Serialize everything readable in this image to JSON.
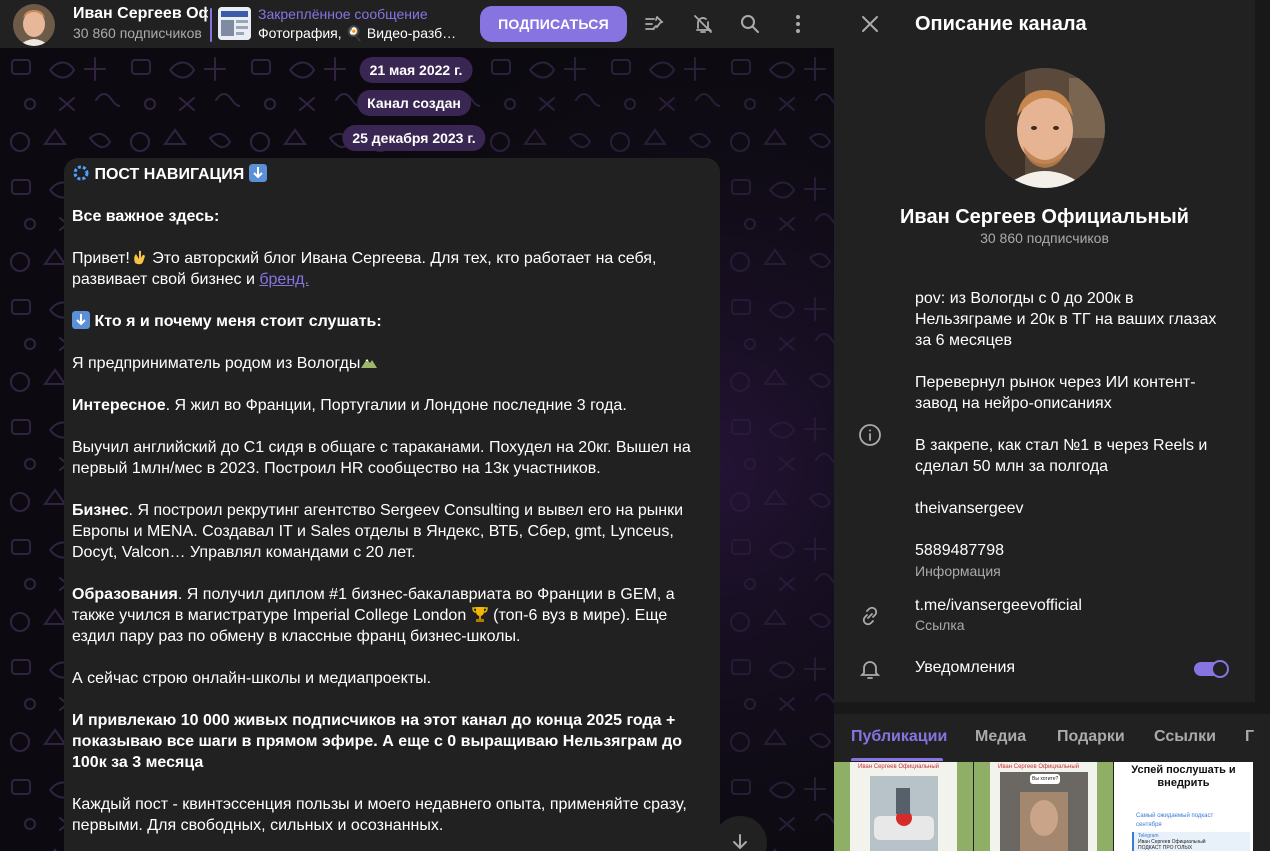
{
  "header": {
    "channel_title": "Иван Сергеев Официальный",
    "subscribers": "30 860 подписчиков",
    "pinned_label": "Закреплённое сообщение",
    "pinned_text": "Фотография, 🍳 Видео-разбор…",
    "subscribe_label": "ПОДПИСАТЬСЯ",
    "icons": [
      "pinned-list-icon",
      "mute-icon",
      "search-icon",
      "more-icon"
    ]
  },
  "chat": {
    "dates": [
      "21 мая 2022 г.",
      "Канал создан",
      "25 декабря 2023 г."
    ],
    "post": {
      "title": "ПОСТ НАВИГАЦИЯ",
      "intro_heading": "Все важное здесь:",
      "greeting": "Привет!",
      "greeting_text": " Это авторский блог Ивана Сергеева. Для тех, кто работает на себя, развивает свой бизнес и ",
      "greeting_link": "бренд.",
      "who_heading": "Кто я и почему меня стоит слушать:",
      "origin": "Я предприниматель родом из Вологды",
      "interesting_bold": "Интересное",
      "interesting_text": ". Я жил во Франции, Португалии и Лондоне последние 3 года.",
      "achievements": "Выучил английский до С1 сидя в общаге с тараканами. Похудел на 20кг. Вышел на первый 1млн/мес в 2023. Построил HR сообщество на 13к участников.",
      "business_bold": "Бизнес",
      "business_text": ". Я построил рекрутинг агентство Sergeev Consulting и вывел его на рынки Европы и MENA. Создавал IT и Sales отделы в Яндекс, ВТБ, Сбер, gmt, Lynceus, Docyt, Valcon… Управлял командами с 20 лет.",
      "education_bold": "Образования",
      "education_text_1": ". Я получил диплом #1 бизнес-бакалавриата во Франции в GEM, а также учился в магистратуре Imperial College London ",
      "education_text_2": " (топ-6 вуз в мире). Еще ездил пару раз по обмену в классные франц бизнес-школы.",
      "now": "А сейчас строю онлайн-школы и медиапроекты.",
      "goal_bold": "И привлекаю 10 000 живых подписчиков на этот канал до конца 2025 года + показываю все шаги в прямом эфире. А еще с 0 выращиваю Нельзяграм до 100к за 3 месяца",
      "closing": "Каждый пост - квинтэссенция пользы и моего недавнего опыта, применяйте сразу, первыми. Для свободных, сильных и осознанных."
    }
  },
  "panel": {
    "title": "Описание канала",
    "name": "Иван Сергеев Официальный",
    "subscribers": "30 860 подписчиков",
    "description": [
      "pov: из Вологды с 0 до 200к в Нельзяграме и 20к в ТГ на ваших глазах за 6 месяцев",
      "Перевернул рынок через ИИ контент-завод на нейро-описаниях",
      "В закрепе, как стал №1 в через Reels и сделал 50 млн за полгода",
      "theivansergeev",
      "5889487798"
    ],
    "info_label": "Информация",
    "link_value": "t.me/ivansergeevofficial",
    "link_label": "Ссылка",
    "notifications_label": "Уведомления",
    "notifications_on": true,
    "tabs": [
      "Публикации",
      "Медиа",
      "Подарки",
      "Ссылки",
      "Г"
    ],
    "active_tab": "Публикации",
    "media_captions": {
      "thumb1_caption": "Иван Сергеев Официальный",
      "thumb2_caption": "Иван Сергеев Официальный",
      "thumb2_question": "Вы хотите?",
      "thumb3_title": "Успей послушать и внедрить",
      "thumb3_line1": "Самый ожидаемый подкаст",
      "thumb3_line2": "сентября",
      "thumb3_meta": "Telegram",
      "thumb3_meta2": "Иван Сергеев Официальный",
      "thumb3_meta3": "ПОДКАСТ ПРО ГОЛЫХ"
    }
  },
  "colors": {
    "accent": "#8774e1",
    "bubble": "#212121",
    "date_chip": "#3a2652",
    "panel_bg": "#212121"
  }
}
